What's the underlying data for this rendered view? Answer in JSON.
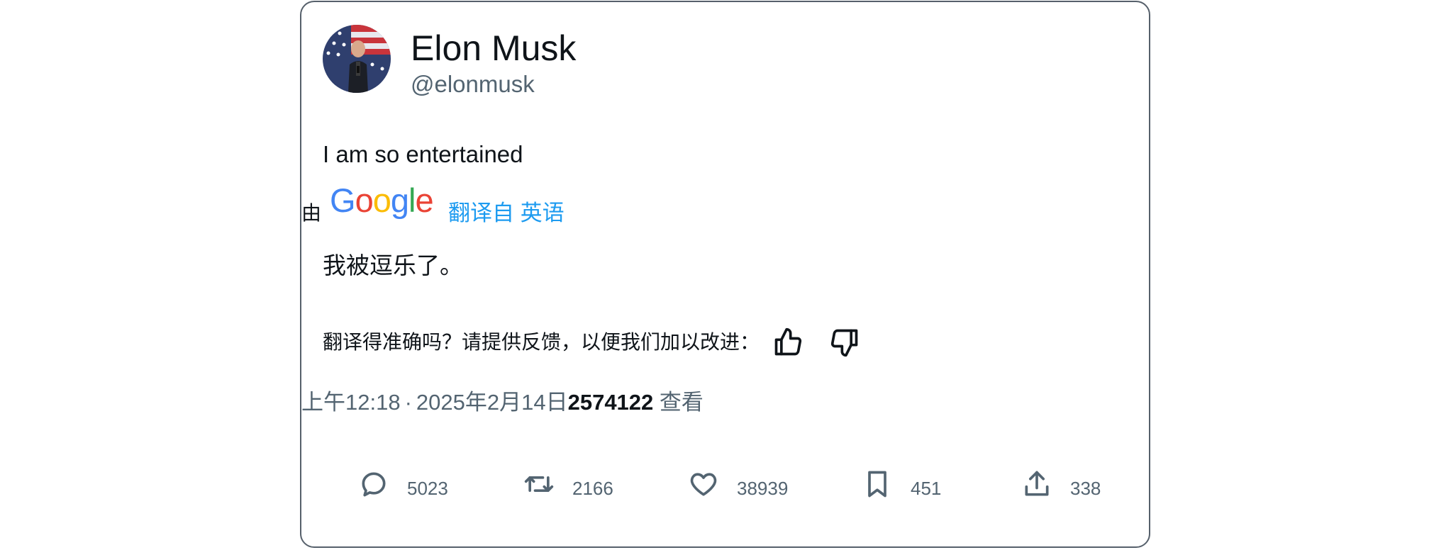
{
  "author": {
    "name": "Elon Musk",
    "handle": "@elonmusk"
  },
  "tweet": {
    "text": "I am so entertained",
    "translation": {
      "by_label": "由",
      "provider": "Google",
      "from_label": "翻译自 英语",
      "text": "我被逗乐了。",
      "feedback_prompt": "翻译得准确吗？请提供反馈，以便我们加以改进："
    },
    "time": "上午12:18",
    "separator": "·",
    "date": "2025年2月14日",
    "views_count": "2574122",
    "views_label": " 查看"
  },
  "actions": {
    "reply_count": "5023",
    "retweet_count": "2166",
    "like_count": "38939",
    "bookmark_count": "451",
    "share_count": "338"
  },
  "icons": {
    "reply": "reply-icon",
    "retweet": "retweet-icon",
    "like": "heart-icon",
    "bookmark": "bookmark-icon",
    "share": "share-icon",
    "thumbs_up": "thumbs-up-icon",
    "thumbs_down": "thumbs-down-icon"
  },
  "colors": {
    "link": "#1d9bf0",
    "secondary_text": "#536471",
    "primary_text": "#0f1419",
    "border": "#56606b"
  }
}
